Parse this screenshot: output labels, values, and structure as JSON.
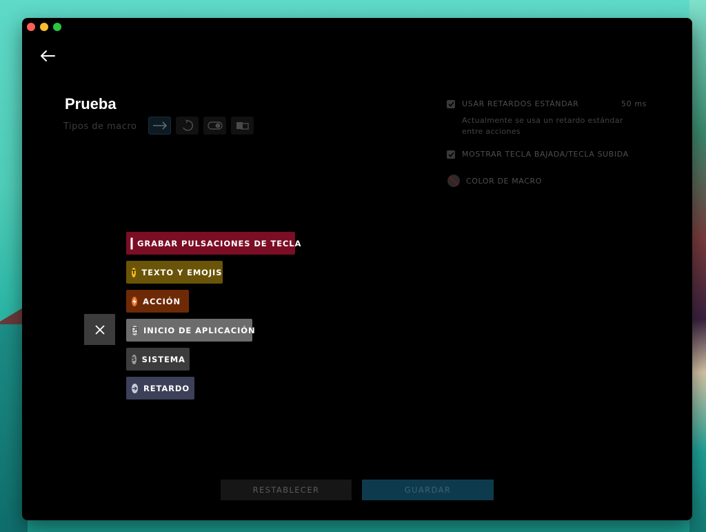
{
  "window": {
    "title": "Prueba",
    "types_label": "Tipos de macro",
    "type_icons": [
      "arrow-right-icon",
      "loop-icon",
      "toggle-icon",
      "sequence-icon"
    ]
  },
  "settings": {
    "use_standard_delays": {
      "label": "USAR RETARDOS ESTÁNDAR",
      "value": "50 ms",
      "checked": true
    },
    "delay_description": "Actualmente se usa un retardo estándar entre acciones",
    "show_key_down_up": {
      "label": "MOSTRAR TECLA BAJADA/TECLA SUBIDA",
      "checked": true
    },
    "macro_color": {
      "label": "COLOR DE MACRO"
    }
  },
  "menu": {
    "items": [
      {
        "label": "GRABAR PULSACIONES DE TECLA",
        "icon": "record-icon",
        "color": "#7b0d25"
      },
      {
        "label": "TEXTO Y EMOJIS",
        "icon": "text-icon",
        "glyph": "T",
        "color": "#6a5408"
      },
      {
        "label": "ACCIÓN",
        "icon": "lightning-icon",
        "color": "#6e2a07"
      },
      {
        "label": "INICIO DE APLICACIÓN",
        "icon": "app-launch-icon",
        "color": "#6c6c6c"
      },
      {
        "label": "SISTEMA",
        "icon": "system-icon",
        "glyph": "S",
        "color": "#3c3c3c"
      },
      {
        "label": "RETARDO",
        "icon": "delay-icon",
        "color": "#3c4058"
      }
    ]
  },
  "footer": {
    "reset_label": "RESTABLECER",
    "save_label": "GUARDAR"
  },
  "colors": {
    "accent_save": "#0e3a4e",
    "record": "#e0173f",
    "text": "#f2b81d",
    "action": "#e86d26"
  }
}
